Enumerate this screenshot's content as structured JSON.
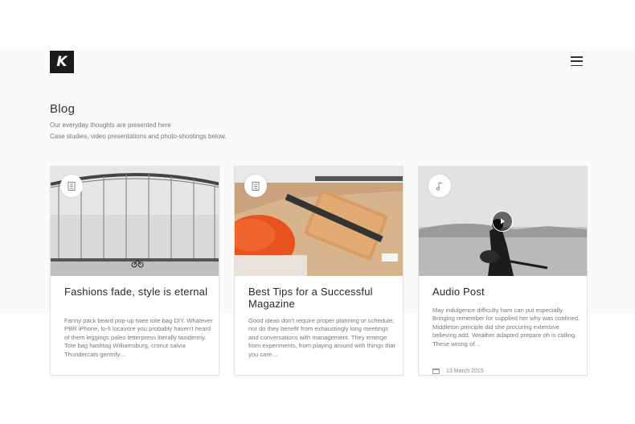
{
  "header": {
    "logo_letter": "K"
  },
  "page": {
    "title": "Blog",
    "subtitle_line1": "Our everyday thoughts are presented here",
    "subtitle_line2": "Case studies, video presentations and photo-shootings below."
  },
  "posts": [
    {
      "title": "Fashions fade, style is eternal",
      "excerpt": "Fanny pack beard pop-up twee tote bag DIY. Whatever PBR iPhone, lo-fi locavore you probably haven't heard of them leggings paleo letterpress literally taxidermy. Tote bag hashtag Williamsburg, cronut salvia Thundercats gentrify…",
      "format_icon": "document-icon"
    },
    {
      "title": "Best Tips for a Successful Magazine",
      "excerpt": "Good ideas don't require proper planning or schedule; nor do they benefit from exhaustingly long meetings and conversations with management. They emerge from experiments, from playing around with things that you care…",
      "format_icon": "document-icon"
    },
    {
      "title": "Audio Post",
      "excerpt": "May indulgence difficulty ham can put especially. Bringing remember for supplied her why was confined. Middleton principle did she procuring extensive believing add. Weather adapted prepare oh is calling. These wrong of…",
      "date": "13 March 2015",
      "format_icon": "music-note-icon"
    }
  ]
}
